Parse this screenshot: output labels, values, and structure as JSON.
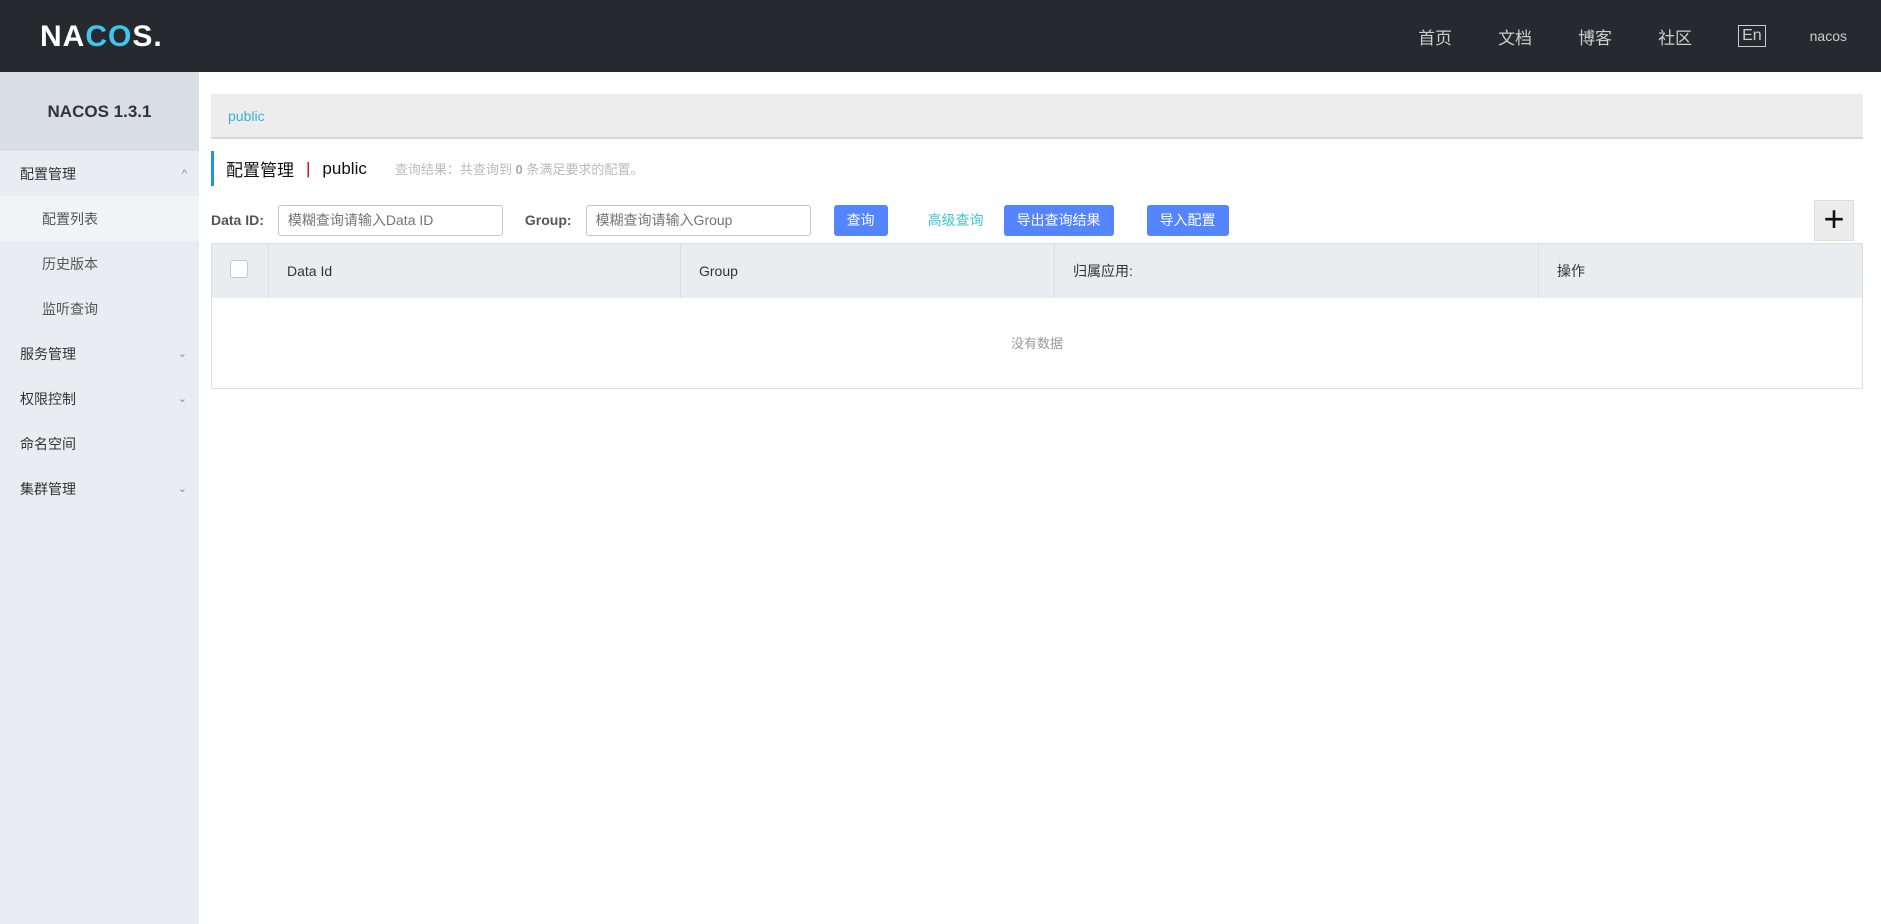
{
  "header": {
    "logo": "NACOS.",
    "nav": [
      "首页",
      "文档",
      "博客",
      "社区"
    ],
    "lang": "En",
    "user": "nacos"
  },
  "sidebar": {
    "title": "NACOS 1.3.1",
    "items": [
      {
        "label": "配置管理",
        "chev": "^"
      },
      {
        "label": "配置列表"
      },
      {
        "label": "历史版本"
      },
      {
        "label": "监听查询"
      },
      {
        "label": "服务管理",
        "chev": "⌄"
      },
      {
        "label": "权限控制",
        "chev": "⌄"
      },
      {
        "label": "命名空间"
      },
      {
        "label": "集群管理",
        "chev": "⌄"
      }
    ]
  },
  "main": {
    "crumb": "public",
    "title": "配置管理",
    "sep": "|",
    "namespace": "public",
    "info_prefix": "查询结果：共查询到",
    "count": "0",
    "info_suffix": "条满足要求的配置。",
    "search": {
      "dataid_label": "Data ID:",
      "dataid_placeholder": "模糊查询请输入Data ID",
      "group_label": "Group:",
      "group_placeholder": "模糊查询请输入Group",
      "query": "查询",
      "advanced": "高级查询",
      "export": "导出查询结果",
      "import": "导入配置",
      "plus": "+"
    },
    "table": {
      "columns": [
        "Data Id",
        "Group",
        "归属应用:",
        "操作"
      ],
      "empty": "没有数据"
    }
  }
}
